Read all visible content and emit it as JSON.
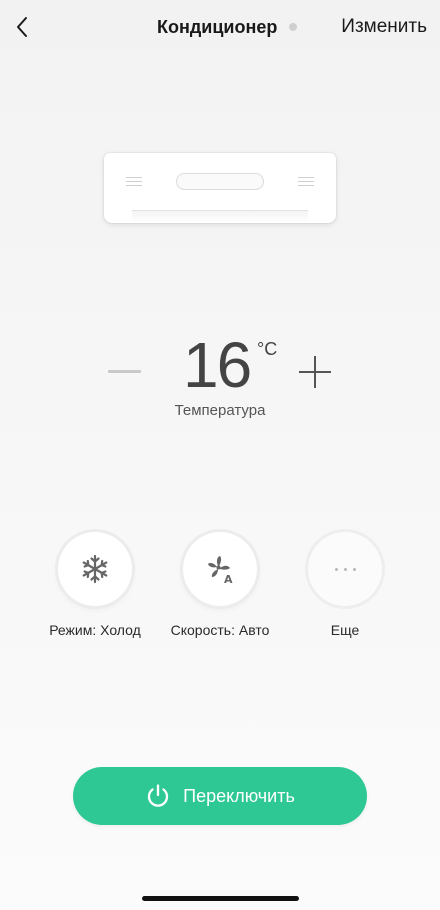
{
  "header": {
    "title": "Кондиционер",
    "edit_label": "Изменить"
  },
  "temperature": {
    "value": "16",
    "unit": "°C",
    "label": "Температура"
  },
  "controls": [
    {
      "label": "Режим: Холод",
      "icon": "snowflake-icon"
    },
    {
      "label": "Скорость: Авто",
      "icon": "fan-auto-icon"
    },
    {
      "label": "Еще",
      "icon": "more-dots-icon"
    }
  ],
  "power": {
    "label": "Переключить",
    "icon": "power-icon"
  },
  "colors": {
    "accent": "#2ec894",
    "icon_gray": "#666666"
  }
}
